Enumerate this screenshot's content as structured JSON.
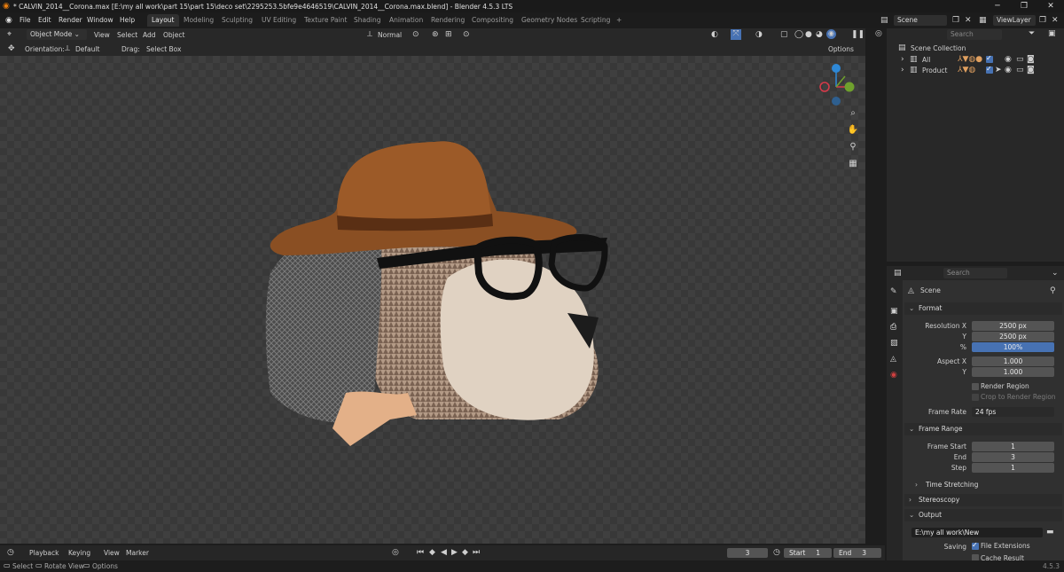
{
  "window": {
    "title": "* CALVIN_2014__Corona.max [E:\\my all work\\part 15\\part 15\\deco set\\2295253.5bfe9e4646519\\CALVIN_2014__Corona.max.blend] - Blender 4.5.3 LTS",
    "minimize": "─",
    "maximize": "❐",
    "close": "✕"
  },
  "menu": [
    "File",
    "Edit",
    "Render",
    "Window",
    "Help"
  ],
  "workspaces": [
    "Layout",
    "Modeling",
    "Sculpting",
    "UV Editing",
    "Texture Paint",
    "Shading",
    "Animation",
    "Rendering",
    "Compositing",
    "Geometry Nodes",
    "Scripting",
    "+"
  ],
  "scene_selector": {
    "scene": "Scene",
    "view_layer": "ViewLayer"
  },
  "viewport_header": {
    "mode": "Object Mode",
    "items": [
      "View",
      "Select",
      "Add",
      "Object"
    ],
    "transform_orientation": "Normal"
  },
  "tool_settings": {
    "orientation_label": "Orientation:",
    "orientation_value": "Default",
    "drag_label": "Drag:",
    "drag_value": "Select Box",
    "options": "Options"
  },
  "outliner": {
    "search_placeholder": "Search",
    "root": "Scene Collection",
    "collections": [
      "All",
      "Product"
    ]
  },
  "properties": {
    "search_placeholder": "Search",
    "context": "Scene",
    "format": {
      "title": "Format",
      "res_x_label": "Resolution X",
      "res_x": "2500 px",
      "res_y_label": "Y",
      "res_y": "2500 px",
      "pct_label": "%",
      "pct": "100%",
      "aspect_x_label": "Aspect X",
      "aspect_x": "1.000",
      "aspect_y_label": "Y",
      "aspect_y": "1.000",
      "render_region": "Render Region",
      "crop": "Crop to Render Region",
      "frame_rate_label": "Frame Rate",
      "frame_rate": "24 fps"
    },
    "frame_range": {
      "title": "Frame Range",
      "start_label": "Frame Start",
      "start": "1",
      "end_label": "End",
      "end": "3",
      "step_label": "Step",
      "step": "1"
    },
    "time_stretching": "Time Stretching",
    "stereoscopy": "Stereoscopy",
    "output": {
      "title": "Output",
      "path": "E:\\my all work\\New folder\\render\\render",
      "saving_label": "Saving",
      "file_ext": "File Extensions",
      "cache": "Cache Result"
    }
  },
  "timeline": {
    "items": [
      "Playback",
      "Keying",
      "View",
      "Marker"
    ],
    "current_frame": "3",
    "start_label": "Start",
    "start": "1",
    "end_label": "End",
    "end": "3"
  },
  "statusbar": {
    "select": "Select",
    "rotate": "Rotate View",
    "options": "Options",
    "version": "4.5.3"
  },
  "colors": {
    "accent": "#4772b3",
    "viewport_bg": "#3a3a3a",
    "hat": "#8a4f23",
    "glasses": "#111111"
  }
}
